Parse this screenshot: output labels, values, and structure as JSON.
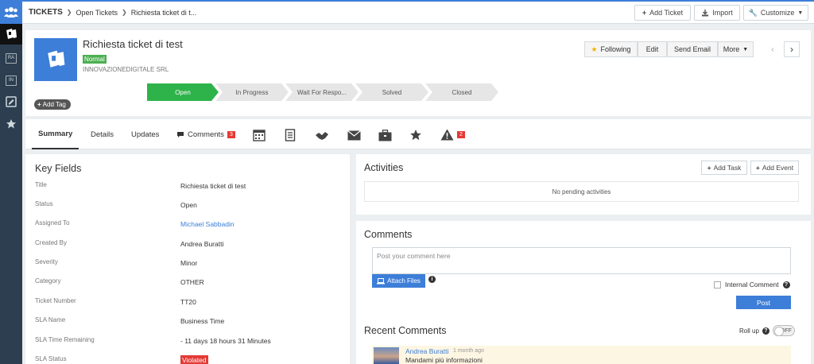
{
  "topbar": {
    "module": "TICKETS",
    "breadcrumb": [
      "Open Tickets",
      "Richiesta ticket di t..."
    ],
    "add_label": "Add Ticket",
    "import_label": "Import",
    "customize_label": "Customize"
  },
  "rail": {
    "items": [
      "RA",
      "IN"
    ]
  },
  "record": {
    "title": "Richiesta ticket di test",
    "priority": "Normal",
    "company": "INNOVAZIONEDIGITALE SRL",
    "add_tag": "Add Tag"
  },
  "header_actions": {
    "following": "Following",
    "edit": "Edit",
    "send_email": "Send Email",
    "more": "More"
  },
  "pipeline": {
    "stages": [
      "Open",
      "In Progress",
      "Wait For Respo...",
      "Solved",
      "Closed"
    ],
    "active_index": 0
  },
  "tabs": {
    "summary": "Summary",
    "details": "Details",
    "updates": "Updates",
    "comments": "Comments",
    "comments_count": "3",
    "alerts_count": "2",
    "icons": [
      "calendar-icon",
      "document-icon",
      "handshake-icon",
      "envelope-icon",
      "briefcase-icon",
      "star-icon",
      "warning-icon"
    ]
  },
  "key_fields": {
    "title": "Key Fields",
    "rows": [
      {
        "label": "Title",
        "value": "Richiesta ticket di test"
      },
      {
        "label": "Status",
        "value": "Open"
      },
      {
        "label": "Assigned To",
        "value": "Michael Sabbadin"
      },
      {
        "label": "Created By",
        "value": "Andrea Buratti"
      },
      {
        "label": "Severity",
        "value": "Minor"
      },
      {
        "label": "Category",
        "value": "OTHER"
      },
      {
        "label": "Ticket Number",
        "value": "TT20"
      },
      {
        "label": "SLA Name",
        "value": "Business Time"
      },
      {
        "label": "SLA Time Remaining",
        "value": "- 11 days 18 hours 31 Minutes"
      },
      {
        "label": "SLA Status",
        "value": "Violated"
      }
    ]
  },
  "activities": {
    "title": "Activities",
    "add_task": "Add Task",
    "add_event": "Add Event",
    "empty": "No pending activities"
  },
  "comments": {
    "title": "Comments",
    "placeholder": "Post your comment here",
    "attach": "Attach Files",
    "internal": "Internal Comment",
    "post": "Post",
    "recent_title": "Recent Comments",
    "roll_up": "Roll up",
    "toggle": "OFF",
    "items": [
      {
        "author": "Andrea Buratti",
        "time": "1 month ago",
        "text": "Mandami più informazioni"
      }
    ]
  },
  "colors": {
    "accent": "#3d7ed8",
    "active_stage": "#2eb34a",
    "danger": "#e53935",
    "rail": "#2c3e50"
  }
}
